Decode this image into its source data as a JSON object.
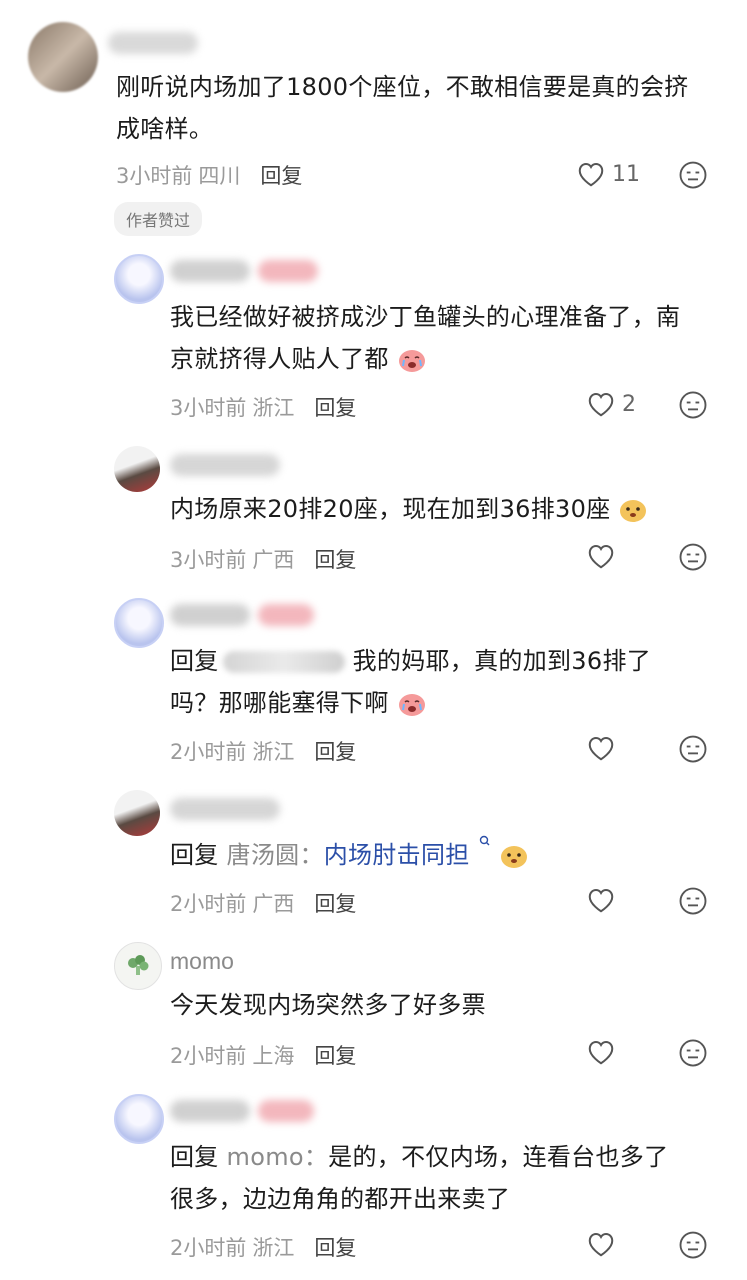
{
  "comments": [
    {
      "body": "刚听说内场加了1800个座位，不敢相信要是真的会挤",
      "body2": "成啥样。",
      "time": "3小时前",
      "location": "四川",
      "reply": "回复",
      "likes": "11",
      "badge": "作者赞过"
    },
    {
      "body": "我已经做好被挤成沙丁鱼罐头的心理准备了，南",
      "body2": "京就挤得人贴人了都",
      "time": "3小时前",
      "location": "浙江",
      "reply": "回复",
      "likes": "2"
    },
    {
      "body": "内场原来20排20座，现在加到36排30座",
      "time": "3小时前",
      "location": "广西",
      "reply": "回复"
    },
    {
      "reply_prefix": "回复",
      "body": "我的妈耶，真的加到36排了",
      "body2": "吗？那哪能塞得下啊",
      "time": "2小时前",
      "location": "浙江",
      "reply": "回复"
    },
    {
      "reply_prefix": "回复",
      "mention": "唐汤圆：",
      "body": "内场肘击同担",
      "time": "2小时前",
      "location": "广西",
      "reply": "回复"
    },
    {
      "username": "momo",
      "body": "今天发现内场突然多了好多票",
      "time": "2小时前",
      "location": "上海",
      "reply": "回复"
    },
    {
      "reply_prefix": "回复",
      "mention": "momo：",
      "body": "是的，不仅内场，连看台也多了",
      "body2": "很多，边边角角的都开出来卖了",
      "time": "2小时前",
      "location": "浙江",
      "reply": "回复"
    }
  ]
}
